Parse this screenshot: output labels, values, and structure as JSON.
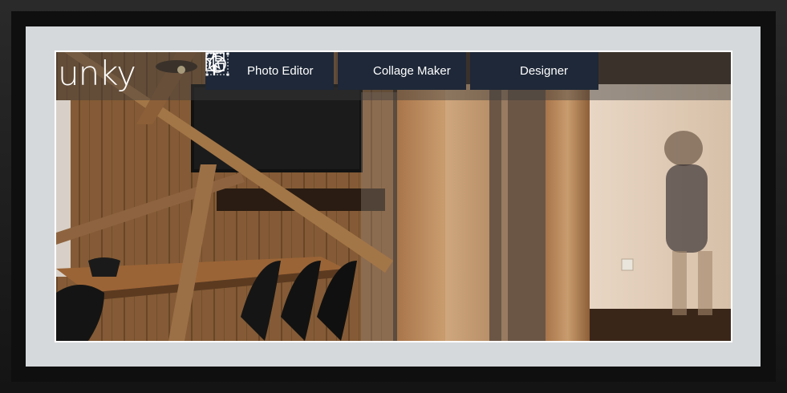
{
  "logo": {
    "text": "unky"
  },
  "tabs": [
    {
      "label": "Photo Editor",
      "icon": "star-wand-icon"
    },
    {
      "label": "Collage Maker",
      "icon": "collage-grid-icon"
    },
    {
      "label": "Designer",
      "icon": "designer-circle-icon"
    }
  ],
  "colors": {
    "tab_background": "#1e2838",
    "mat": "#d6d9db",
    "frame": "#1b1b1b"
  }
}
